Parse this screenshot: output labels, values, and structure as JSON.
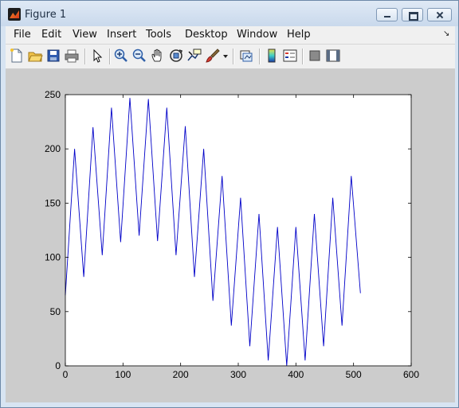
{
  "window": {
    "title": "Figure 1"
  },
  "menu": {
    "items": [
      "File",
      "Edit",
      "View",
      "Insert",
      "Tools",
      "Desktop",
      "Window",
      "Help"
    ]
  },
  "toolbar": {
    "icons": [
      "new-figure-icon",
      "open-file-icon",
      "save-icon",
      "print-icon",
      "pointer-icon",
      "zoom-in-icon",
      "zoom-out-icon",
      "pan-icon",
      "rotate-3d-icon",
      "data-cursor-icon",
      "brush-icon",
      "brush-dropdown-icon",
      "link-plot-icon",
      "colorbar-icon",
      "legend-icon",
      "hide-plot-tools-icon",
      "show-plot-tools-icon"
    ]
  },
  "colors": {
    "line": "#0000c8",
    "figure_bg": "#cccccc",
    "axes_bg": "#ffffff"
  },
  "chart_data": {
    "type": "line",
    "xlim": [
      0,
      600
    ],
    "ylim": [
      0,
      250
    ],
    "x_ticks": [
      0,
      100,
      200,
      300,
      400,
      500,
      600
    ],
    "y_ticks": [
      0,
      50,
      100,
      150,
      200,
      250
    ],
    "x_tick_labels": [
      "0",
      "100",
      "200",
      "300",
      "400",
      "500",
      "600"
    ],
    "y_tick_labels": [
      "0",
      "50",
      "100",
      "150",
      "200",
      "250"
    ],
    "grid": false,
    "series": [
      {
        "x": [
          0,
          16,
          32,
          48,
          64,
          80,
          96,
          112,
          128,
          144,
          160,
          176,
          192,
          208,
          224,
          240,
          256,
          272,
          288,
          304,
          320,
          336,
          352,
          368,
          384,
          400,
          416,
          432,
          448,
          464,
          480,
          496,
          512
        ],
        "y": [
          65,
          200,
          82,
          220,
          102,
          238,
          114,
          247,
          120,
          246,
          115,
          238,
          102,
          221,
          82,
          200,
          60,
          175,
          37,
          155,
          18,
          140,
          5,
          128,
          0,
          128,
          5,
          140,
          18,
          155,
          37,
          175,
          67
        ]
      }
    ]
  }
}
